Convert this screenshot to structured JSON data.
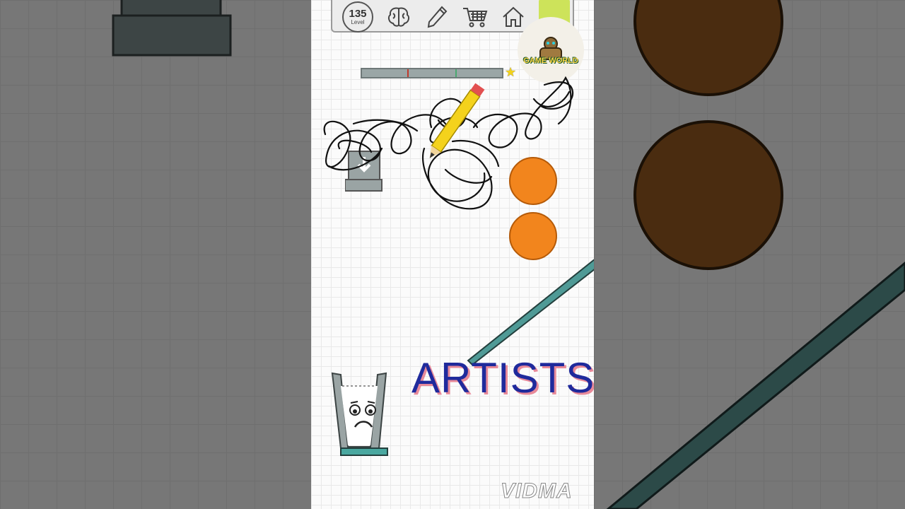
{
  "hud": {
    "level_number": "135",
    "level_label": "Level",
    "icons": [
      "brain-icon",
      "pencil-icon",
      "cart-icon",
      "home-icon"
    ]
  },
  "logo": {
    "text": "GAME WORLD"
  },
  "progress": {
    "star_marker": "★"
  },
  "caption": "ARTISTS",
  "watermark": "VIDMA",
  "colors": {
    "ball": "#f2851d",
    "ramp": "#4f9a96",
    "glass_base": "#4aa8a0",
    "caption": "#1f2a9c",
    "caption_shadow": "#e88a9a"
  }
}
